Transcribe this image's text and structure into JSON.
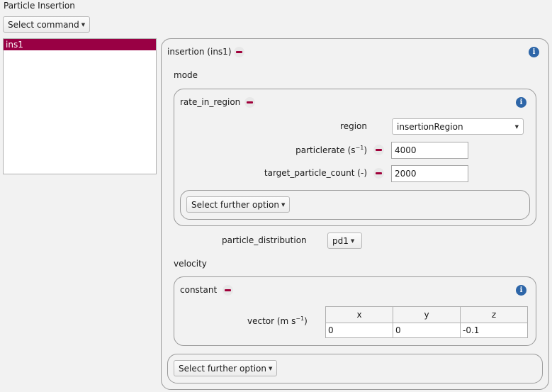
{
  "title": "Particle Insertion",
  "select_command": "Select command",
  "list": {
    "items": [
      "ins1"
    ]
  },
  "insertion": {
    "header": "insertion (ins1)",
    "mode_label": "mode",
    "rate": {
      "header": "rate_in_region",
      "region_label": "region",
      "region_value": "insertionRegion",
      "particlerate_label": "particlerate (s",
      "particlerate_sup": "−1",
      "particlerate_suffix": ")",
      "particlerate_value": "4000",
      "target_label": "target_particle_count (-)",
      "target_value": "2000",
      "further_option": "Select further option"
    },
    "distribution_label": "particle_distribution",
    "distribution_value": "pd1",
    "velocity_label": "velocity",
    "constant": {
      "header": "constant",
      "vector_label_main": "vector (m s",
      "vector_label_sup": "−1",
      "vector_label_suffix": ")",
      "columns": [
        "x",
        "y",
        "z"
      ],
      "values": [
        "0",
        "0",
        "-0.1"
      ]
    },
    "further_option": "Select further option"
  },
  "colors": {
    "accent": "#a0003a",
    "info": "#2e66a8",
    "selection": "#990044"
  }
}
